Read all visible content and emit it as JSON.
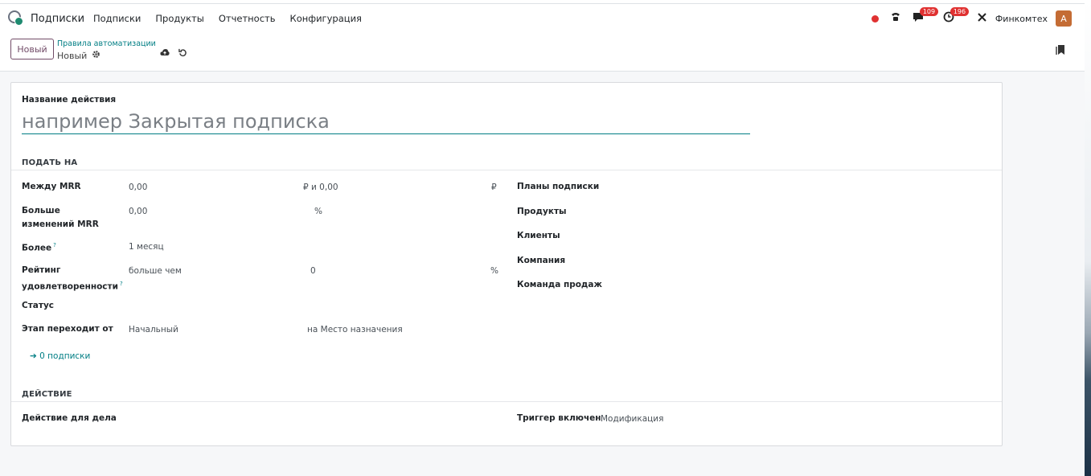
{
  "navbar": {
    "app_name": "Подписки",
    "menu": [
      "Подписки",
      "Продукты",
      "Отчетность",
      "Конфигурация"
    ],
    "messages_count": "109",
    "activities_count": "196",
    "company": "Финкомтех",
    "avatar_letter": "A"
  },
  "control_panel": {
    "new_button": "Новый",
    "breadcrumb_parent": "Правила автоматизации",
    "breadcrumb_current": "Новый"
  },
  "form": {
    "name_label": "Название действия",
    "name_placeholder": "например Закрытая подписка",
    "section_apply": "ПОДАТЬ НА",
    "section_action": "ДЕЙСТВИЕ",
    "left_fields": {
      "mrr_between": {
        "label": "Между MRR",
        "from": "0,00",
        "and": "₽ и 0,00",
        "currency": "₽"
      },
      "mrr_change": {
        "label": "Больше изменений MRR",
        "value": "0,00",
        "unit": "%"
      },
      "over": {
        "label": "Более",
        "help": "?",
        "value": "1 месяц"
      },
      "rating": {
        "label": "Рейтинг удовлетворенности",
        "help": "?",
        "operator": "больше чем",
        "value": "0",
        "unit": "%"
      },
      "status": {
        "label": "Статус"
      },
      "stage": {
        "label": "Этап переходит от",
        "from": "Начальный",
        "to": "на Место назначения"
      }
    },
    "subscriptions_link": "➔ 0 подписки",
    "right_fields": [
      "Планы подписки",
      "Продукты",
      "Клиенты",
      "Компания",
      "Команда продаж"
    ],
    "activity_action_label": "Действие для дела",
    "trigger_label": "Триггер включен",
    "trigger_value": "Модификация"
  }
}
